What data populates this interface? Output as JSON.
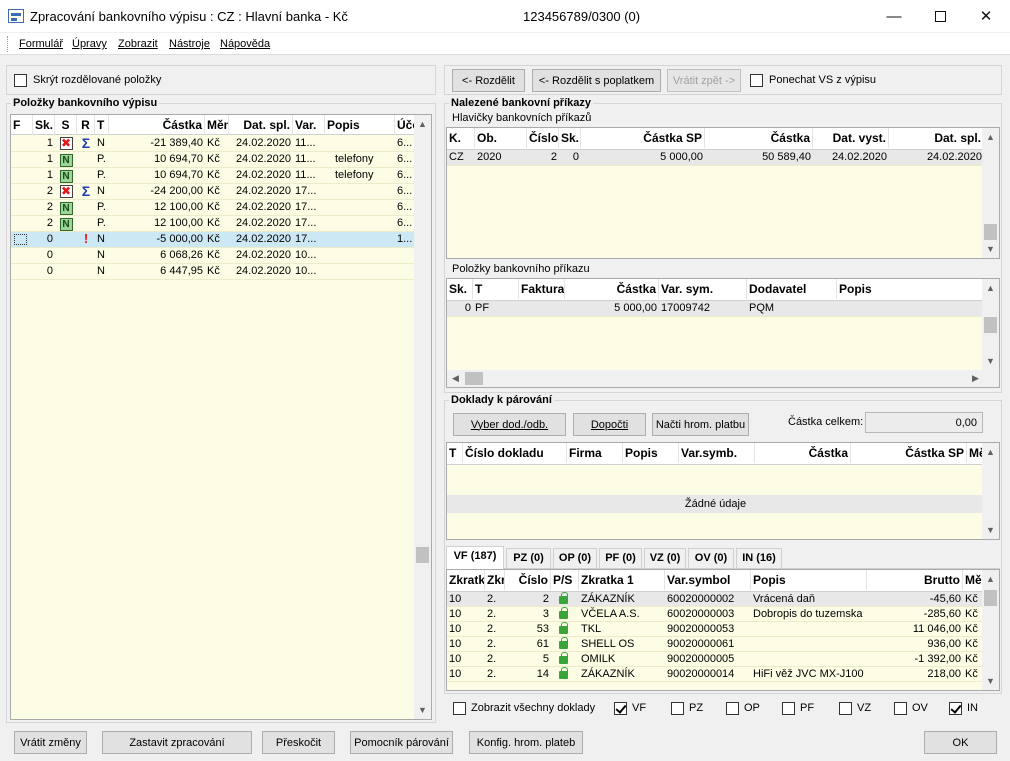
{
  "window": {
    "title": "Zpracování bankovního výpisu : CZ : Hlavní banka - Kč",
    "account": "123456789/0300 (0)"
  },
  "menu": [
    "Formulář",
    "Úpravy",
    "Zobrazit",
    "Nástroje",
    "Nápověda"
  ],
  "left": {
    "hide_split_label": "Skrýt rozdělované položky",
    "group_title": "Položky bankovního výpisu",
    "columns": [
      "F",
      "Sk.",
      "S",
      "R",
      "T",
      "Částka",
      "Měna",
      "Dat. spl.",
      "Var.",
      "Popis",
      "Účet"
    ],
    "rows": [
      {
        "sk": "1",
        "s": "x",
        "r": "sum",
        "t": "N",
        "castka": "-21 389,40",
        "mena": "Kč",
        "dat": "24.02.2020",
        "var": "11...",
        "popis": "",
        "ucet": "6..."
      },
      {
        "sk": "1",
        "s": "n",
        "r": "",
        "t": "P.",
        "castka": "10 694,70",
        "mena": "Kč",
        "dat": "24.02.2020",
        "var": "11...",
        "popis": "telefony",
        "ucet": "6..."
      },
      {
        "sk": "1",
        "s": "n",
        "r": "",
        "t": "P.",
        "castka": "10 694,70",
        "mena": "Kč",
        "dat": "24.02.2020",
        "var": "11...",
        "popis": "telefony",
        "ucet": "6..."
      },
      {
        "sk": "2",
        "s": "x",
        "r": "sum",
        "t": "N",
        "castka": "-24 200,00",
        "mena": "Kč",
        "dat": "24.02.2020",
        "var": "17...",
        "popis": "",
        "ucet": "6..."
      },
      {
        "sk": "2",
        "s": "n",
        "r": "",
        "t": "P.",
        "castka": "12 100,00",
        "mena": "Kč",
        "dat": "24.02.2020",
        "var": "17...",
        "popis": "",
        "ucet": "6..."
      },
      {
        "sk": "2",
        "s": "n",
        "r": "",
        "t": "P.",
        "castka": "12 100,00",
        "mena": "Kč",
        "dat": "24.02.2020",
        "var": "17...",
        "popis": "",
        "ucet": "6..."
      },
      {
        "sk": "0",
        "s": "",
        "r": "exc",
        "t": "N",
        "castka": "-5 000,00",
        "mena": "Kč",
        "dat": "24.02.2020",
        "var": "17...",
        "popis": "",
        "ucet": "1...",
        "selected": true
      },
      {
        "sk": "0",
        "s": "",
        "r": "",
        "t": "N",
        "castka": "6 068,26",
        "mena": "Kč",
        "dat": "24.02.2020",
        "var": "10...",
        "popis": "",
        "ucet": ""
      },
      {
        "sk": "0",
        "s": "",
        "r": "",
        "t": "N",
        "castka": "6 447,95",
        "mena": "Kč",
        "dat": "24.02.2020",
        "var": "10...",
        "popis": "",
        "ucet": ""
      }
    ]
  },
  "right": {
    "split_label": "<- Rozdělit",
    "split_fee_label": "<- Rozdělit s poplatkem",
    "return_label": "Vrátit zpět ->",
    "keep_vs_label": "Ponechat VS z výpisu",
    "found_title": "Nalezené bankovní příkazy",
    "headers_title": "Hlavičky bankovních příkazů",
    "headers_columns": [
      "K.",
      "Ob.",
      "Číslo",
      "Sk.",
      "Částka SP",
      "Částka",
      "Dat. vyst.",
      "Dat. spl."
    ],
    "headers_rows": [
      {
        "k": "CZ",
        "ob": "2020",
        "cislo": "2",
        "sk": "0",
        "castka_sp": "5 000,00",
        "castka": "50 589,40",
        "dat_vyst": "24.02.2020",
        "dat_spl": "24.02.2020"
      }
    ],
    "items_title": "Položky bankovního příkazu",
    "items_columns": [
      "Sk.",
      "T",
      "Faktura",
      "Částka",
      "Var. sym.",
      "Dodavatel",
      "Popis"
    ],
    "items_rows": [
      {
        "sk": "0",
        "t": "PF",
        "faktura": "",
        "castka": "5 000,00",
        "var": "17009742",
        "dodavatel": "PQM",
        "popis": ""
      }
    ],
    "docs_title": "Doklady k párování",
    "btn_select": "Vyber dod./odb.",
    "btn_calc": "Dopočti",
    "btn_load": "Načti hrom. platbu",
    "total_label": "Částka celkem:",
    "total_value": "0,00",
    "docs_columns": [
      "T",
      "Číslo dokladu",
      "Firma",
      "Popis",
      "Var.symb.",
      "Částka",
      "Částka SP",
      "Měna"
    ],
    "docs_empty": "Žádné údaje",
    "tabs": [
      "VF (187)",
      "PZ (0)",
      "OP (0)",
      "PF (0)",
      "VZ (0)",
      "OV (0)",
      "IN (16)"
    ],
    "list_columns": [
      "Zkratka",
      "Zkratka",
      "Číslo",
      "P/S",
      "Zkratka 1",
      "Var.symbol",
      "Popis",
      "Brutto",
      "Měna"
    ],
    "list_rows": [
      {
        "a": "10",
        "b": "2.",
        "cislo": "2",
        "firma": "ZÁKAZNÍK",
        "vs": "60020000002",
        "popis": "Vrácená daň",
        "brutto": "-45,60",
        "mena": "Kč"
      },
      {
        "a": "10",
        "b": "2.",
        "cislo": "3",
        "firma": "VČELA A.S.",
        "vs": "60020000003",
        "popis": "Dobropis do tuzemska",
        "brutto": "-285,60",
        "mena": "Kč"
      },
      {
        "a": "10",
        "b": "2.",
        "cislo": "53",
        "firma": "TKL",
        "vs": "90020000053",
        "popis": "",
        "brutto": "11 046,00",
        "mena": "Kč"
      },
      {
        "a": "10",
        "b": "2.",
        "cislo": "61",
        "firma": "SHELL OS",
        "vs": "90020000061",
        "popis": "",
        "brutto": "936,00",
        "mena": "Kč"
      },
      {
        "a": "10",
        "b": "2.",
        "cislo": "5",
        "firma": "OMILK",
        "vs": "90020000005",
        "popis": "",
        "brutto": "-1 392,00",
        "mena": "Kč"
      },
      {
        "a": "10",
        "b": "2.",
        "cislo": "14",
        "firma": "ZÁKAZNÍK",
        "vs": "90020000014",
        "popis": "HiFi věž JVC MX-J100",
        "brutto": "218,00",
        "mena": "Kč"
      }
    ],
    "show_all_label": "Zobrazit všechny doklady",
    "filters": [
      {
        "label": "VF",
        "checked": true
      },
      {
        "label": "PZ",
        "checked": false
      },
      {
        "label": "OP",
        "checked": false
      },
      {
        "label": "PF",
        "checked": false
      },
      {
        "label": "VZ",
        "checked": false
      },
      {
        "label": "OV",
        "checked": false
      },
      {
        "label": "IN",
        "checked": true
      }
    ]
  },
  "footer": {
    "undo": "Vrátit změny",
    "stop": "Zastavit zpracování",
    "skip": "Přeskočit",
    "helper": "Pomocník párování",
    "config": "Konfig. hrom. plateb",
    "ok": "OK"
  },
  "colors": {
    "grid_bg": "#fdfde6",
    "selected_row": "#cde8f5",
    "header_row": "#e8e8e8"
  }
}
